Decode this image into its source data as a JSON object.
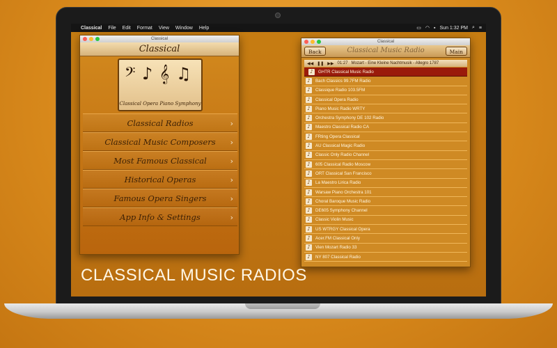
{
  "menubar": {
    "items": [
      "Classical",
      "File",
      "Edit",
      "Format",
      "View",
      "Window",
      "Help"
    ],
    "clock": "Sun 1:32 PM"
  },
  "left_window": {
    "window_title": "Classical",
    "header_title": "Classical",
    "logo_caption": "Classical  Opera  Piano  Symphony",
    "logo_notes": "𝄢 ♪ 𝄞 ♫",
    "menu": [
      {
        "label": "Classical Radios"
      },
      {
        "label": "Classical Music Composers"
      },
      {
        "label": "Most Famous Classical"
      },
      {
        "label": "Historical Operas"
      },
      {
        "label": "Famous Opera Singers"
      },
      {
        "label": "App Info & Settings"
      }
    ]
  },
  "right_window": {
    "window_title": "Classical",
    "back_label": "Back",
    "toolbar_title": "Classical Music Radio",
    "main_label": "Main",
    "player": {
      "time": "01:27",
      "now_playing": "Mozart - Eine Kleine Nachtmusik - Allegro 1787"
    },
    "stations": [
      "GHTR Classical Music Radio",
      "Bach Classics 99.7FM Radio",
      "Classique Radio 103.5FM",
      "Classical Opera Radio",
      "Piano Music Radio WRTY",
      "Orchestra Symphony DE 102 Radio",
      "Maestro Classical Radio CA",
      "FRting Opera Classical",
      "AU Classical Magic Radio",
      "Classic Only Radio Channel",
      "605 Classical Radio Moscow",
      "ORT Classical San Francisco",
      "La Maestro Lirica Radio",
      "Warsaw Piano Orchestra 101",
      "Choral Baroque Music Radio",
      "DE605 Symphony Channel",
      "Classic Violin Music",
      "US WTRGY Classical Opera",
      "Acer.FM Classical Only",
      "Vien Mozart Radio 33",
      "NY 807 Classical Radio"
    ]
  },
  "caption": "CLASSICAL MUSIC RADIOS",
  "colors": {
    "background": "#e39a2a",
    "selected_row": "#9a1b0b",
    "wood": "#e2c08a"
  }
}
